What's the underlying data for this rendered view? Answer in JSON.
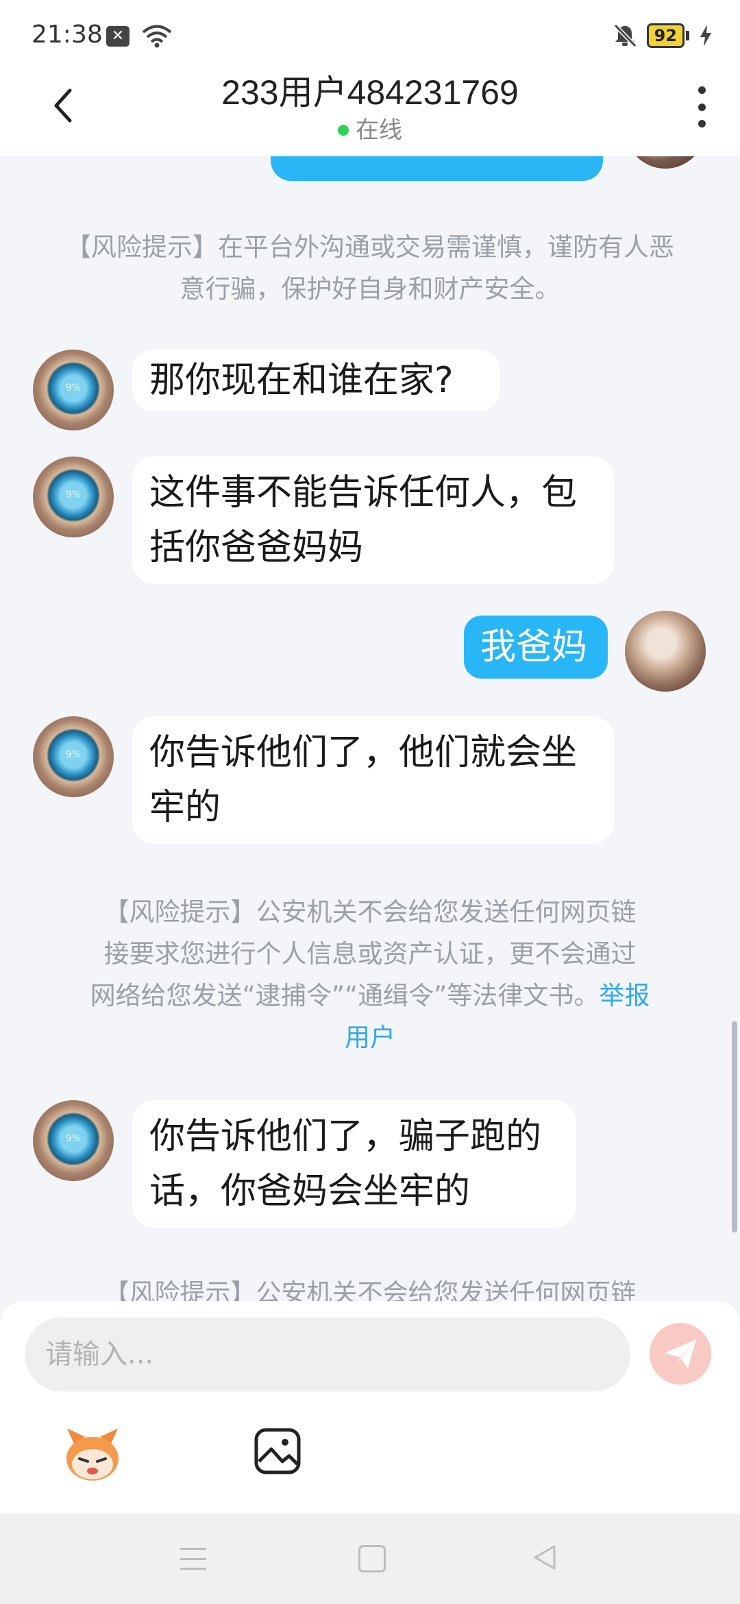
{
  "status_bar": {
    "time": "21:38",
    "battery": "92"
  },
  "header": {
    "title": "233用户484231769",
    "status": "在线"
  },
  "chat": {
    "risk_notice_1": "【风险提示】在平台外沟通或交易需谨慎，谨防有人恶意行骗，保护好自身和财产安全。",
    "messages": [
      {
        "sender": "other",
        "text": "那你现在和谁在家?"
      },
      {
        "sender": "other",
        "line1": "这件事不能告诉任何人，包",
        "line2": "括你爸爸妈妈"
      },
      {
        "sender": "me",
        "text": "我爸妈"
      },
      {
        "sender": "other",
        "line1": "你告诉他们了，他们就会坐",
        "line2": "牢的"
      },
      {
        "sender": "other",
        "line1": "你告诉他们了，骗子跑的",
        "line2": "话，你爸妈会坐牢的"
      }
    ],
    "risk_notice_2": {
      "line1": "【风险提示】公安机关不会给您发送任何网页链",
      "line2": "接要求您进行个人信息或资产认证，更不会通过",
      "line3": "网络给您发送“逮捕令”“通缉令”等法律文书。",
      "report_part1": "举报",
      "report_part2": "用户"
    },
    "risk_notice_3_partial": "【风险提示】公安机关不会给您发送任何网页链",
    "avatar_badge": "9%"
  },
  "input": {
    "placeholder": "请输入..."
  },
  "icons": {
    "back": "chevron-left-icon",
    "more": "more-vertical-icon",
    "send": "paper-plane-icon",
    "emoji": "mascot-emoji-icon",
    "image": "image-icon"
  },
  "colors": {
    "accent": "#29b6f6",
    "online": "#2fd15a",
    "report_link": "#2fa8ec",
    "send_disabled": "#f9c9c4"
  }
}
